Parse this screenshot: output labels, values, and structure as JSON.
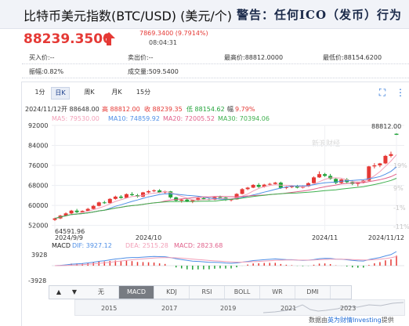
{
  "header": {
    "title": "比特币美元指数(BTC/USD) (美元/个)",
    "warning": "警告：任何ICO（发币）行为"
  },
  "quote": {
    "price": "88239.3500",
    "change": "7869.3400 (9.7914%)",
    "time": "08:04:31"
  },
  "stats": {
    "open_label": "买入价:--",
    "ask_label": "卖出价:--",
    "high_label": "最高价:88812.0000",
    "low_label": "最低价:88154.6200",
    "amplitude_label": "振幅:0.82%",
    "volume_label": "成交量:509.5400"
  },
  "period_tabs": [
    "1分",
    "日K",
    "周K",
    "月K",
    "15分"
  ],
  "active_period": "日K",
  "controls": {
    "fullscreen_icon": "⛶",
    "more_icon": "⋮"
  },
  "ohlc_line": {
    "date": "2024/11/12",
    "open": "开 88648.00",
    "high": "高 88812.00",
    "close": "收 88239.35",
    "low": "低 88154.62",
    "pct": "9.79%"
  },
  "ma_legend": [
    {
      "label": "MA5: 79530.00",
      "color": "#f2a0b8"
    },
    {
      "label": "MA10: 74859.92",
      "color": "#4f8fe6"
    },
    {
      "label": "MA20: 72005.52",
      "color": "#e0608a"
    },
    {
      "label": "MA30: 70394.06",
      "color": "#3fb04f"
    }
  ],
  "macd_legend": [
    {
      "label": "MACD",
      "color": "#222222"
    },
    {
      "label": "DIF: 3927.12",
      "color": "#4f8fe6"
    },
    {
      "label": "DEA: 2515.28",
      "color": "#f2a0b8"
    },
    {
      "label": "MACD: 2823.68",
      "color": "#e0608a"
    }
  ],
  "watermark": "新浪财经",
  "indicator_tabs": [
    "无",
    "MACD",
    "KDJ",
    "RSI",
    "BOLL",
    "WR",
    "DMI"
  ],
  "active_indicator": "MACD",
  "timeline_years": [
    "2015",
    "2017",
    "2019",
    "2021",
    "2023"
  ],
  "source": {
    "prefix": "数据由",
    "link": "英为财情Investing",
    "suffix": "提供"
  },
  "chart_data": {
    "type": "candlestick",
    "y_ticks": [
      92000,
      84000,
      76000,
      68000,
      60000,
      52000
    ],
    "right_axis_ticks": [
      "19%",
      "9%",
      "-1%",
      "-11%"
    ],
    "ylim": [
      50000,
      92000
    ],
    "x_ticks": [
      "2024/9/9",
      "2024/10",
      "2024/11",
      "2024/11/12"
    ],
    "max_label": "88812.00",
    "min_label": "64591.96",
    "candles": [
      [
        54200,
        55100,
        53800,
        54800
      ],
      [
        54800,
        56200,
        54500,
        55900
      ],
      [
        55900,
        57200,
        55600,
        56800
      ],
      [
        56800,
        58200,
        56400,
        57900
      ],
      [
        57900,
        58600,
        56900,
        57300
      ],
      [
        57300,
        58000,
        57100,
        57800
      ],
      [
        57800,
        59000,
        57500,
        58600
      ],
      [
        58600,
        60200,
        58400,
        59800
      ],
      [
        59800,
        61500,
        59600,
        61200
      ],
      [
        61200,
        61800,
        60600,
        60900
      ],
      [
        60900,
        62900,
        60800,
        62600
      ],
      [
        62600,
        63900,
        62300,
        63500
      ],
      [
        63500,
        64100,
        62700,
        63000
      ],
      [
        63000,
        64800,
        62900,
        64500
      ],
      [
        64500,
        65300,
        63800,
        64100
      ],
      [
        64100,
        64600,
        63100,
        63500
      ],
      [
        63500,
        65400,
        63300,
        65200
      ],
      [
        65200,
        66100,
        64800,
        65700
      ],
      [
        65700,
        66400,
        65300,
        66000
      ],
      [
        66000,
        66500,
        64900,
        65200
      ],
      [
        65200,
        65900,
        64600,
        65600
      ],
      [
        65600,
        65800,
        62700,
        63200
      ],
      [
        63200,
        63500,
        61500,
        61900
      ],
      [
        61900,
        62600,
        61100,
        62300
      ],
      [
        62300,
        62800,
        61300,
        61600
      ],
      [
        61600,
        62400,
        60900,
        62100
      ],
      [
        62100,
        63100,
        61800,
        62900
      ],
      [
        62900,
        63400,
        62200,
        62500
      ],
      [
        62500,
        62900,
        62000,
        62300
      ],
      [
        62300,
        63600,
        62100,
        63300
      ],
      [
        63300,
        63900,
        62800,
        63100
      ],
      [
        63100,
        63300,
        61800,
        62100
      ],
      [
        62100,
        62700,
        61600,
        62400
      ],
      [
        62400,
        64900,
        62300,
        64600
      ],
      [
        64600,
        66900,
        64400,
        66500
      ],
      [
        66500,
        67400,
        66100,
        67100
      ],
      [
        67100,
        68500,
        66900,
        68200
      ],
      [
        68200,
        68900,
        67000,
        67400
      ],
      [
        67400,
        68600,
        67100,
        68300
      ],
      [
        68300,
        69000,
        67900,
        68600
      ],
      [
        68600,
        69400,
        68300,
        69100
      ],
      [
        69100,
        69500,
        66600,
        67000
      ],
      [
        67000,
        67700,
        66500,
        67300
      ],
      [
        67300,
        68100,
        66900,
        67800
      ],
      [
        67800,
        68200,
        66800,
        67100
      ],
      [
        67100,
        68000,
        66800,
        67600
      ],
      [
        67600,
        69200,
        67400,
        68900
      ],
      [
        68900,
        71600,
        68800,
        71200
      ],
      [
        71200,
        73600,
        71000,
        72500
      ],
      [
        72500,
        73000,
        71400,
        71800
      ],
      [
        71800,
        72600,
        70300,
        70600
      ],
      [
        70600,
        70900,
        68500,
        69000
      ],
      [
        69000,
        70600,
        68700,
        70400
      ],
      [
        70400,
        70900,
        68900,
        69300
      ],
      [
        69300,
        70000,
        68100,
        68600
      ],
      [
        68600,
        69500,
        67600,
        69200
      ],
      [
        69200,
        70200,
        68800,
        69900
      ],
      [
        69900,
        75800,
        69700,
        75600
      ],
      [
        75600,
        76900,
        74800,
        76000
      ],
      [
        76000,
        77000,
        75300,
        76800
      ],
      [
        76800,
        80200,
        76500,
        79800
      ],
      [
        79800,
        81500,
        79200,
        80500
      ],
      [
        88648,
        88812,
        88154.62,
        88239.35
      ]
    ],
    "ma_colors": [
      "#f2a0b8",
      "#4f8fe6",
      "#e0608a",
      "#3fb04f"
    ],
    "macd_ticks": [
      "3928",
      "-3928"
    ],
    "up_color": "#e53935",
    "down_color": "#22a33a"
  }
}
